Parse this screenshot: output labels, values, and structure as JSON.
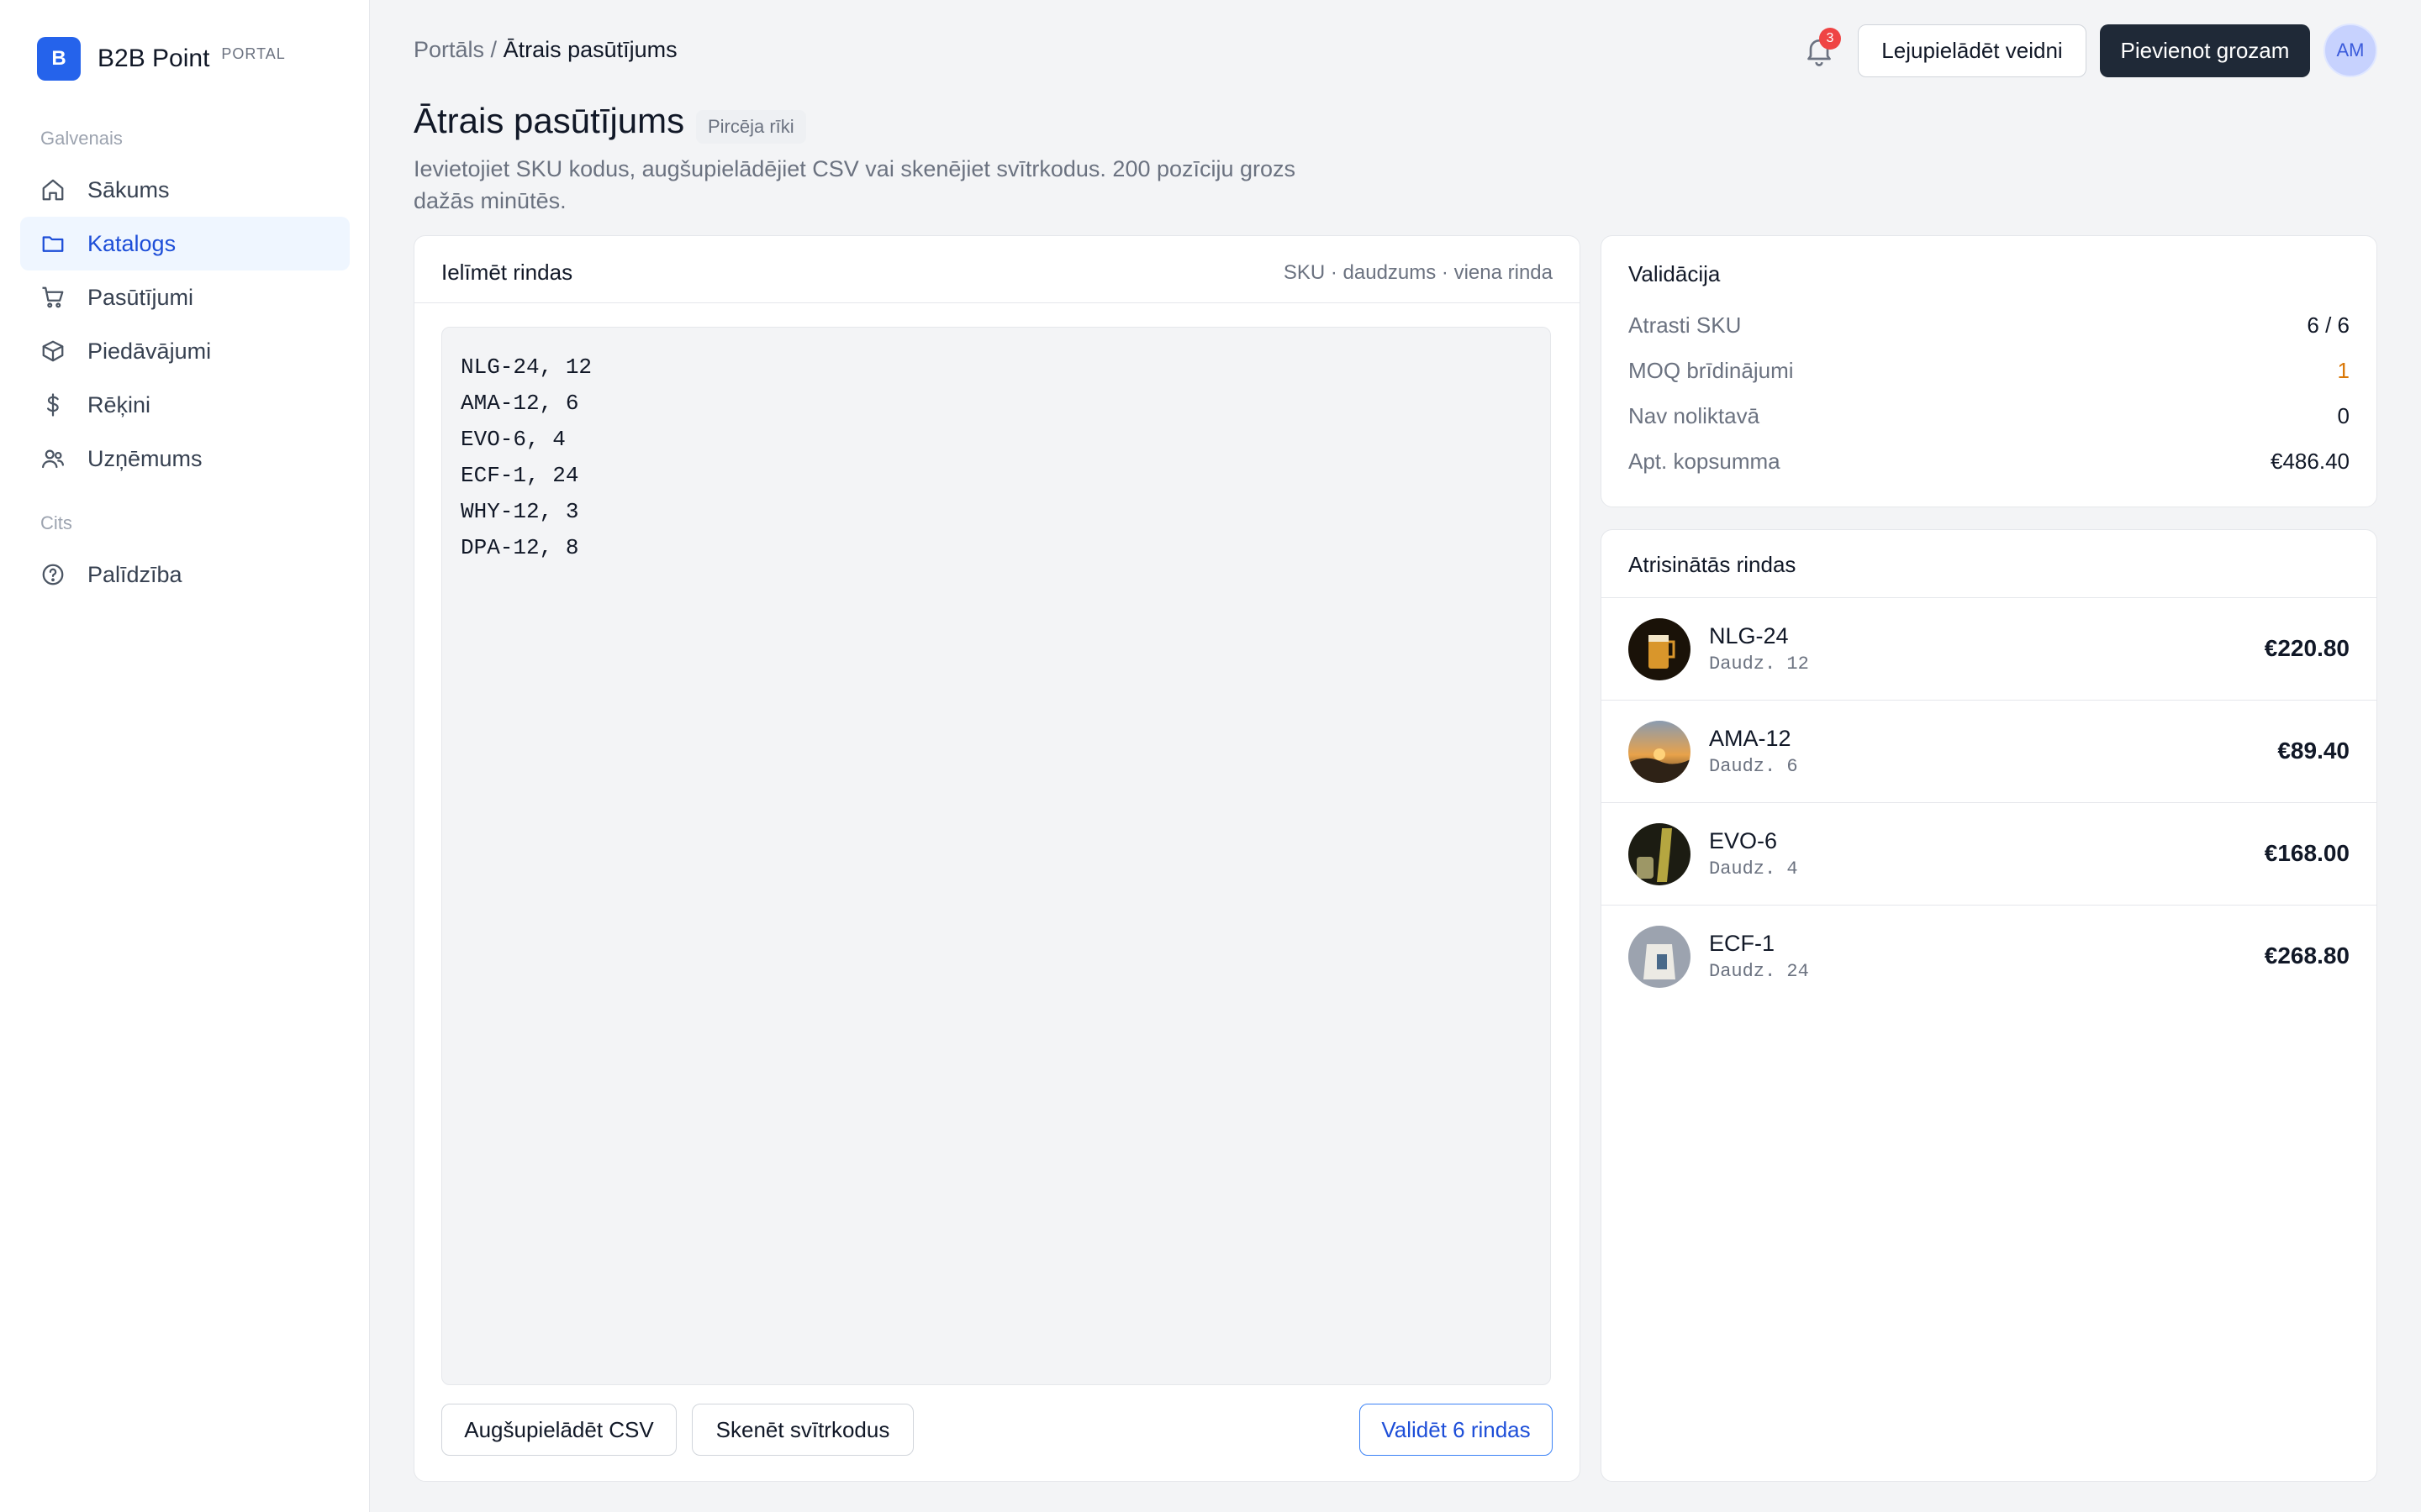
{
  "brand": {
    "logo_letter": "B",
    "name": "B2B Point",
    "tag": "PORTAL"
  },
  "sidebar": {
    "section_main": "Galvenais",
    "section_other": "Cits",
    "items": [
      {
        "label": "Sākums",
        "icon": "home-icon"
      },
      {
        "label": "Katalogs",
        "icon": "folder-icon",
        "active": true
      },
      {
        "label": "Pasūtījumi",
        "icon": "cart-icon"
      },
      {
        "label": "Piedāvājumi",
        "icon": "box-icon"
      },
      {
        "label": "Rēķini",
        "icon": "dollar-icon"
      },
      {
        "label": "Uzņēmums",
        "icon": "users-icon"
      },
      {
        "label": "Palīdzība",
        "icon": "help-icon"
      }
    ]
  },
  "header": {
    "breadcrumb_root": "Portāls /",
    "breadcrumb_current": "Ātrais pasūtījums",
    "notification_count": "3",
    "download_template": "Lejupielādēt veidni",
    "add_to_cart": "Pievienot grozam",
    "avatar_initials": "AM"
  },
  "page": {
    "title": "Ātrais pasūtījums",
    "chip": "Pircēja rīki",
    "description": "Ievietojiet SKU kodus, augšupielādējiet CSV vai skenējiet svītrkodus. 200 pozīciju grozs dažās minūtēs."
  },
  "paste_card": {
    "title": "Ielīmēt rindas",
    "hint": "SKU · daudzums · viena rinda",
    "content": "NLG-24, 12\nAMA-12, 6\nEVO-6, 4\nECF-1, 24\nWHY-12, 3\nDPA-12, 8",
    "upload_csv": "Augšupielādēt CSV",
    "scan_barcodes": "Skenēt svītrkodus",
    "validate": "Validēt 6 rindas"
  },
  "validation": {
    "title": "Validācija",
    "rows": [
      {
        "label": "Atrasti SKU",
        "value": "6 / 6"
      },
      {
        "label": "MOQ brīdinājumi",
        "value": "1"
      },
      {
        "label": "Nav noliktavā",
        "value": "0"
      },
      {
        "label": "Apt. kopsumma",
        "value": "€486.40"
      }
    ]
  },
  "resolved": {
    "title": "Atrisinātās rindas",
    "rows": [
      {
        "sku": "NLG-24",
        "qty": "Daudz. 12",
        "price": "€220.80"
      },
      {
        "sku": "AMA-12",
        "qty": "Daudz. 6",
        "price": "€89.40"
      },
      {
        "sku": "EVO-6",
        "qty": "Daudz. 4",
        "price": "€168.00"
      },
      {
        "sku": "ECF-1",
        "qty": "Daudz. 24",
        "price": "€268.80"
      }
    ]
  },
  "colors": {
    "accent": "#2563eb",
    "dark_button": "#1f2937",
    "warning": "#d97706",
    "badge": "#ef4444"
  }
}
